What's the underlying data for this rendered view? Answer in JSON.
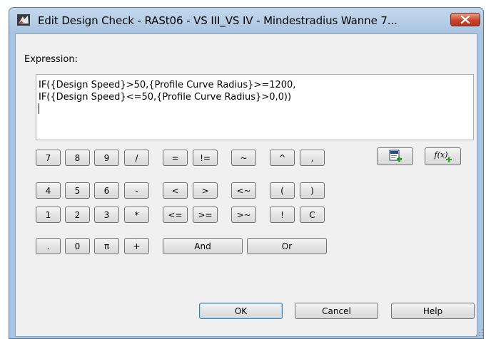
{
  "window": {
    "title": "Edit Design Check - RASt06 - VS III_VS IV - Mindestradius Wanne 7..."
  },
  "expression": {
    "label": "Expression:",
    "lines": [
      "IF({Design Speed}>50,{Profile Curve Radius}>=1200,",
      "IF({Design Speed}<=50,{Profile Curve Radius}>0,0))"
    ]
  },
  "keypad": {
    "digits": [
      "7",
      "8",
      "9",
      "/",
      "4",
      "5",
      "6",
      "-",
      "1",
      "2",
      "3",
      "*",
      ".",
      "0",
      "π",
      "+"
    ],
    "operators": [
      "=",
      "!=",
      "~",
      "^",
      ",",
      "<",
      ">",
      "<~",
      "(",
      ")",
      "<=",
      ">=",
      ">~",
      "!",
      "C"
    ],
    "and_label": "And",
    "or_label": "Or"
  },
  "tools": {
    "insert_property_icon": "insert-property-icon",
    "insert_function_icon": "insert-function-icon",
    "function_glyph": "f(x)"
  },
  "footer": {
    "ok_label": "OK",
    "cancel_label": "Cancel",
    "help_label": "Help"
  },
  "colors": {
    "titlebar": "#a9c4e0",
    "close": "#c7452c",
    "client": "#f0f0f0"
  }
}
